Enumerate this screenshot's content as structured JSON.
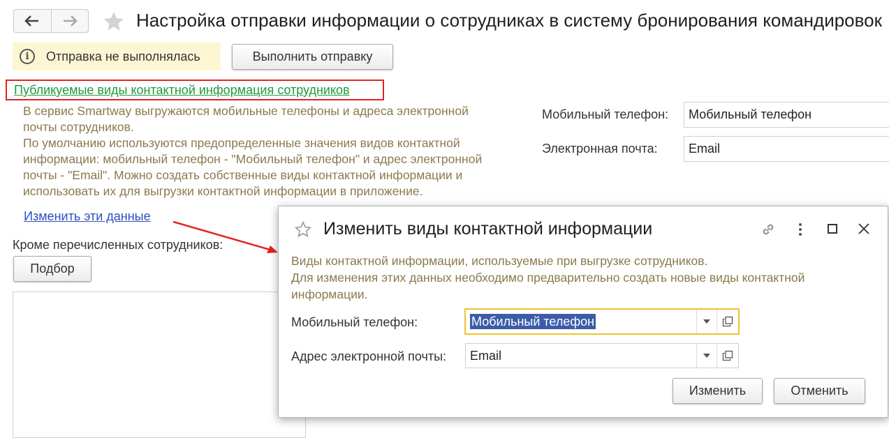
{
  "header": {
    "title": "Настройка отправки информации о сотрудниках в систему бронирования командировок"
  },
  "status": {
    "text": "Отправка не выполнялась",
    "run_button": "Выполнить отправку"
  },
  "section": {
    "link": "Публикуемые виды контактной информация сотрудников",
    "description": [
      "В сервис Smartway выгружаются мобильные телефоны и адреса электронной",
      "почты сотрудников.",
      "По умолчанию используются предопределенные значения видов контактной",
      "информации: мобильный телефон - \"Мобильный телефон\" и адрес электронной",
      "почты - \"Email\". Можно создать собственные виды контактной информации и",
      "использовать их для выгрузки контактной информации в приложение."
    ],
    "mobile_label": "Мобильный телефон:",
    "mobile_value": "Мобильный телефон",
    "email_label": "Электронная почта:",
    "email_value": "Email",
    "change_link": "Изменить эти данные",
    "except_label": "Кроме перечисленных сотрудников:",
    "select_button": "Подбор"
  },
  "dialog": {
    "title": "Изменить виды контактной информации",
    "note": [
      "Виды контактной информации, используемые при выгрузке сотрудников.",
      "Для изменения этих данных необходимо предварительно создать новые виды контактной",
      "информации."
    ],
    "mobile_label": "Мобильный телефон:",
    "mobile_value": "Мобильный телефон",
    "email_label": "Адрес электронной почты:",
    "email_value": "Email",
    "ok_button": "Изменить",
    "cancel_button": "Отменить"
  },
  "colors": {
    "link_green": "#1d9a3f",
    "link_blue": "#2b4fbf",
    "highlight_red": "#e3231f",
    "note_text": "#8a7a4b",
    "focus_border": "#f0c22d",
    "status_bg": "#fdf6d3"
  },
  "icons": [
    "back-arrow-icon",
    "forward-arrow-icon",
    "star-icon",
    "info-icon",
    "link-icon",
    "more-icon",
    "maximize-icon",
    "close-icon",
    "chevron-down-icon",
    "open-icon"
  ]
}
